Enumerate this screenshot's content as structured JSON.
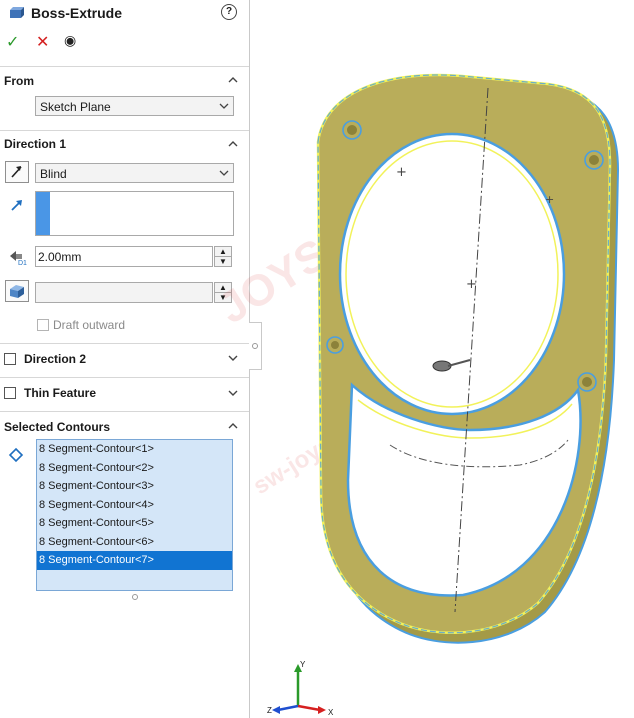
{
  "feature": {
    "title": "Boss-Extrude",
    "help": "?"
  },
  "actions": {
    "ok": "✓",
    "cancel": "✕",
    "preview": "◉"
  },
  "from": {
    "title": "From",
    "value": "Sketch Plane"
  },
  "direction1": {
    "title": "Direction 1",
    "end_condition": "Blind",
    "depth": "2.00mm",
    "draft_label": "Draft outward"
  },
  "direction2": {
    "title": "Direction 2"
  },
  "thin_feature": {
    "title": "Thin Feature"
  },
  "selected_contours": {
    "title": "Selected Contours",
    "items": [
      "8 Segment-Contour<1>",
      "8 Segment-Contour<2>",
      "8 Segment-Contour<3>",
      "8 Segment-Contour<4>",
      "8 Segment-Contour<5>",
      "8 Segment-Contour<6>",
      "8 Segment-Contour<7>"
    ],
    "selected_index": 6
  },
  "triad": {
    "y": "Y",
    "x": "X",
    "z": "Z"
  },
  "watermark": {
    "line1": "JOYSUN",
    "line2": "sw-joysun.com.cn"
  },
  "colors": {
    "accent": "#1174d2",
    "part_fill": "#b9ad5a",
    "part_edge": "#4a9ee0",
    "highlight": "#f2f25a"
  }
}
